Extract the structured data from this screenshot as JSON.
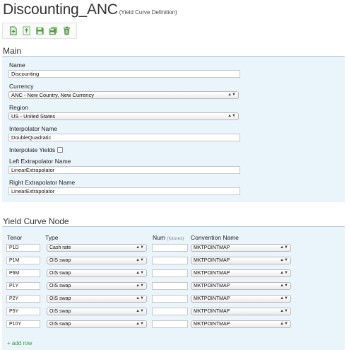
{
  "header": {
    "title": "Discounting_ANC",
    "subtitle": "(Yield Curve Definition)"
  },
  "toolbar": {
    "icons": [
      "new-icon",
      "upload-icon",
      "save-icon",
      "save-as-icon",
      "delete-icon"
    ],
    "icon_color": "#4a9b3a"
  },
  "main": {
    "section_title": "Main",
    "name_label": "Name",
    "name_value": "Discounting",
    "currency_label": "Currency",
    "currency_value": "ANC - New Country, New Currency",
    "region_label": "Region",
    "region_value": "US - United States",
    "interpolator_label": "Interpolator Name",
    "interpolator_value": "DoubleQuadratic",
    "interpolate_yields_label": "Interpolate Yields",
    "interpolate_yields_checked": false,
    "left_extrapolator_label": "Left Extrapolator Name",
    "left_extrapolator_value": "LinearExtrapolator",
    "right_extrapolator_label": "Right Extrapolator Name",
    "right_extrapolator_value": "LinearExtrapolator"
  },
  "yield_curve_node": {
    "section_title": "Yield Curve Node",
    "columns": {
      "tenor": "Tenor",
      "type": "Type",
      "num": "Num",
      "num_hint": "(futures)",
      "convention": "Convention Name"
    },
    "rows": [
      {
        "tenor": "P1D",
        "type": "Cash rate",
        "num": "",
        "convention": "MKTPOINTMAP"
      },
      {
        "tenor": "P1M",
        "type": "OIS swap",
        "num": "",
        "convention": "MKTPOINTMAP"
      },
      {
        "tenor": "P6M",
        "type": "OIS swap",
        "num": "",
        "convention": "MKTPOINTMAP"
      },
      {
        "tenor": "P1Y",
        "type": "OIS swap",
        "num": "",
        "convention": "MKTPOINTMAP"
      },
      {
        "tenor": "P2Y",
        "type": "OIS swap",
        "num": "",
        "convention": "MKTPOINTMAP"
      },
      {
        "tenor": "P5Y",
        "type": "OIS swap",
        "num": "",
        "convention": "MKTPOINTMAP"
      },
      {
        "tenor": "P10Y",
        "type": "OIS swap",
        "num": "",
        "convention": "MKTPOINTMAP"
      }
    ],
    "add_row_label": "+ add row"
  },
  "colors": {
    "panel_bg": "#eaf4fb",
    "section_rule": "#a9c8dd",
    "add_link": "#3c9a3c"
  }
}
